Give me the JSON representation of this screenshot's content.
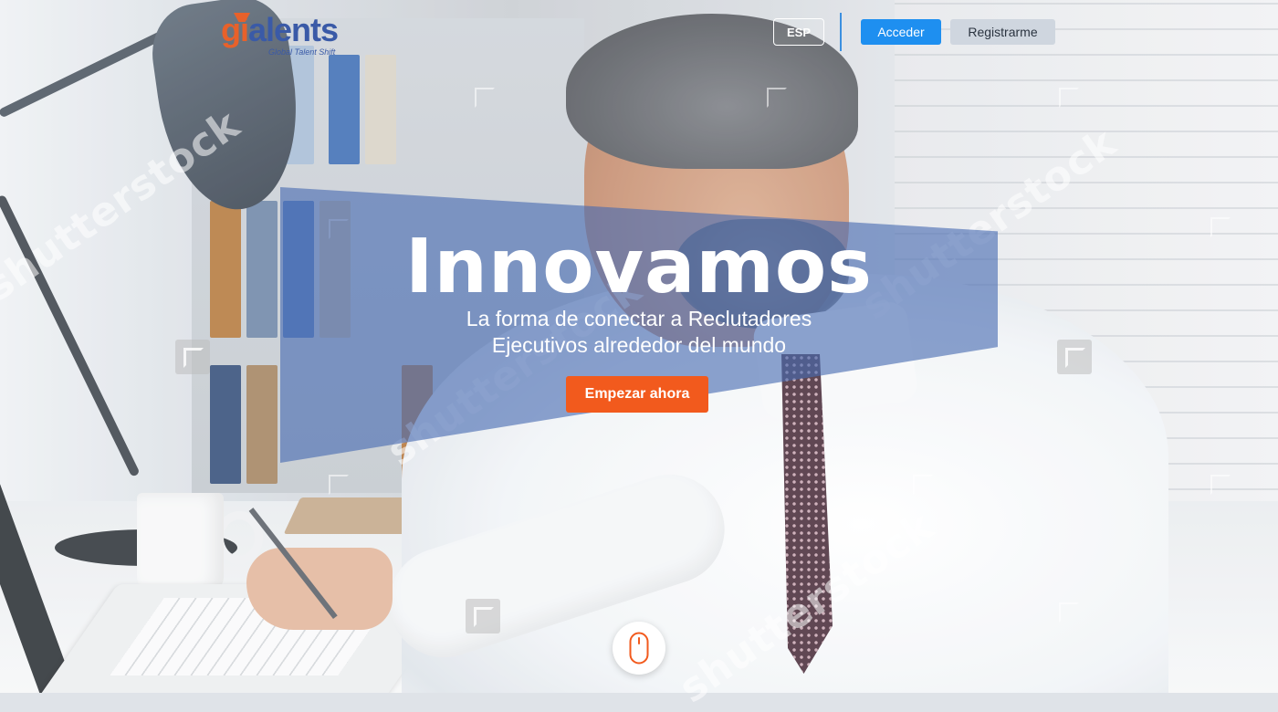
{
  "header": {
    "logo": {
      "name": "gtalents",
      "tagline": "Global Talent Shift"
    },
    "language_button": "ESP",
    "login_button": "Acceder",
    "register_button": "Registrarme"
  },
  "hero": {
    "title": "Innovamos",
    "subtitle_line1": "La forma de conectar a Reclutadores",
    "subtitle_line2": "Ejecutivos alrededor del mundo",
    "cta_button": "Empezar ahora",
    "band_color": "#476ab2"
  },
  "scroll_indicator": {
    "icon": "mouse-icon"
  },
  "watermark": {
    "text": "shutterstock"
  },
  "colors": {
    "brand_blue": "#3a5aa7",
    "brand_orange": "#e8612a",
    "login_blue": "#1e8ff0",
    "cta_orange": "#f25a1d"
  }
}
